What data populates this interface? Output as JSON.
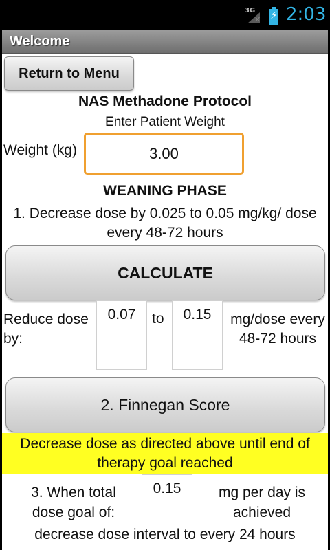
{
  "status_bar": {
    "network_label": "3G",
    "network_icon": "signal-no-service-icon",
    "battery_icon": "battery-charging-icon",
    "time": "2:03",
    "accent_color": "#33b5e5"
  },
  "app": {
    "title": "Welcome",
    "return_button": "Return to Menu",
    "protocol_title": "NAS Methadone Protocol",
    "enter_weight_prompt": "Enter Patient Weight",
    "weight_label": "Weight (kg)",
    "weight_value": "3.00",
    "phase_title": "WEANING PHASE",
    "step1_text": "1. Decrease dose by 0.025 to 0.05 mg/kg/ dose every 48-72 hours",
    "calculate_button": "CALCULATE",
    "reduce_label": "Reduce dose by:",
    "reduce_low": "0.07",
    "reduce_to": "to",
    "reduce_high": "0.15",
    "reduce_unit": "mg/dose every 48-72 hours",
    "finnegan_button": "2. Finnegan Score",
    "banner_text": "Decrease dose as directed above until end of therapy goal reached",
    "banner_color": "#ffff22",
    "goal_label": "3. When total dose goal of:",
    "goal_value": "0.15",
    "goal_unit": "mg per day is achieved",
    "interval_text": "decrease dose interval to every 24 hours",
    "focus_color": "#f0a030"
  }
}
